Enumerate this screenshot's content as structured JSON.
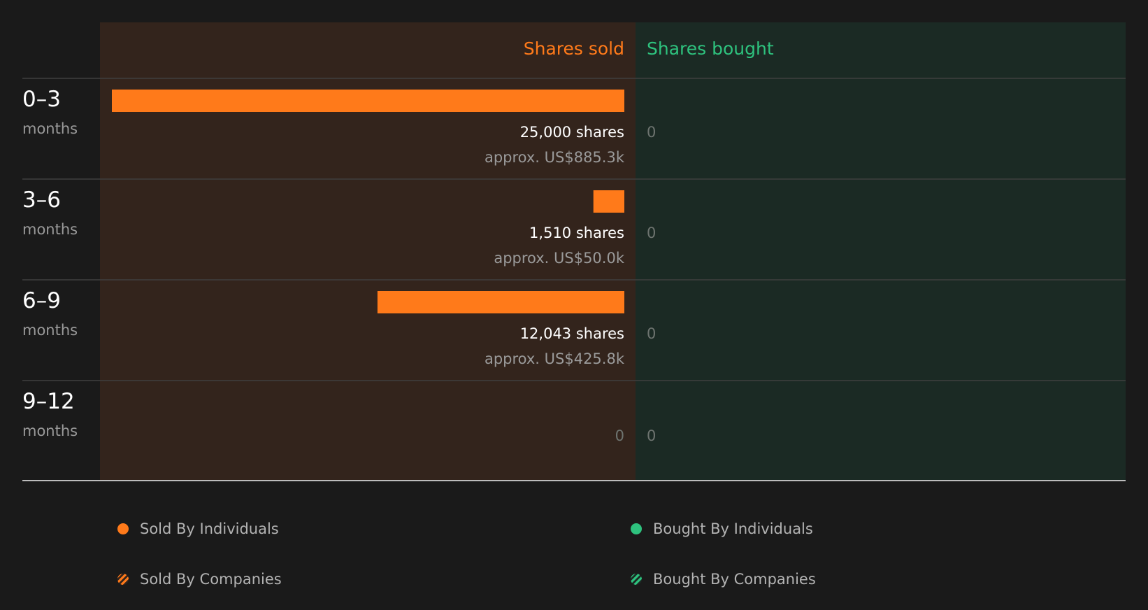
{
  "colors": {
    "background": "#1a1a1a",
    "sold_panel": "#33241c",
    "bought_panel": "#1b2a24",
    "sold": "#ff7a1a",
    "bought": "#2ec27e",
    "label": "#ffffff",
    "muted": "#9a9a9a",
    "zero": "#6e7470",
    "divider": "#3f3f3f"
  },
  "chart_data": {
    "type": "bar",
    "headers": {
      "sold": "Shares sold",
      "bought": "Shares bought"
    },
    "categories": [
      {
        "range": "0–3",
        "unit": "months"
      },
      {
        "range": "3–6",
        "unit": "months"
      },
      {
        "range": "6–9",
        "unit": "months"
      },
      {
        "range": "9–12",
        "unit": "months"
      }
    ],
    "series": [
      {
        "name": "Shares sold",
        "values": [
          25000,
          1510,
          12043,
          0
        ],
        "labels": [
          "25,000 shares",
          "1,510 shares",
          "12,043 shares",
          "0"
        ],
        "value_labels": [
          "approx. US$885.3k",
          "approx. US$50.0k",
          "approx. US$425.8k",
          ""
        ]
      },
      {
        "name": "Shares bought",
        "values": [
          0,
          0,
          0,
          0
        ],
        "labels": [
          "0",
          "0",
          "0",
          "0"
        ]
      }
    ],
    "xlim": [
      0,
      25000
    ]
  },
  "legend": {
    "sold_individuals": "Sold By Individuals",
    "sold_companies": "Sold By Companies",
    "bought_individuals": "Bought By Individuals",
    "bought_companies": "Bought By Companies"
  }
}
